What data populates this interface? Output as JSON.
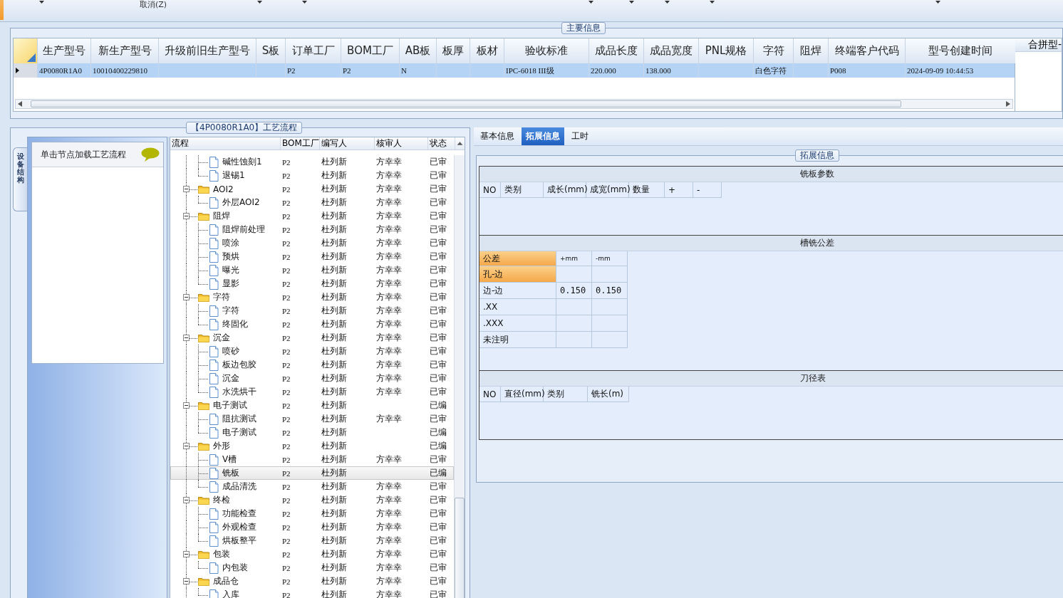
{
  "toolbar": {
    "cancel_label": "取消(Z)"
  },
  "main_info": {
    "title": "主要信息",
    "columns": [
      "生产型号",
      "新生产型号",
      "升级前旧生产型号",
      "S板",
      "订单工厂",
      "BOM工厂",
      "AB板",
      "板厚",
      "板材",
      "验收标准",
      "成品长度",
      "成品宽度",
      "PNL规格",
      "字符",
      "阻焊",
      "终端客户代码",
      "型号创建时间"
    ],
    "rows": [
      {
        "selected": true,
        "cells": [
          "4P0080R1A0",
          "10010400229810",
          null,
          null,
          "P2",
          "P2",
          "N",
          null,
          null,
          "IPC-6018 III级",
          "220.000",
          "138.000",
          null,
          "白色字符",
          null,
          "P008",
          "2024-09-09 10:44:53"
        ]
      }
    ],
    "side_header": "合拼型-"
  },
  "process": {
    "title": "【4P0080R1A0】工艺流程",
    "side_tab": "设备结构",
    "hint": "单击节点加载工艺流程",
    "columns": [
      "流程",
      "BOM工厂",
      "编写人",
      "核审人",
      "状态"
    ],
    "tree": [
      {
        "kind": "continued",
        "children": [
          {
            "kind": "leaf",
            "label": "碱性蚀刻1",
            "bom": "P2",
            "writer": "杜列新",
            "reviewer": "方幸幸",
            "status": "已审",
            "selected": false
          },
          {
            "kind": "leaf",
            "label": "退锡1",
            "bom": "P2",
            "writer": "杜列新",
            "reviewer": "方幸幸",
            "status": "已审",
            "selected": false
          }
        ]
      },
      {
        "kind": "folder",
        "label": "AOI2",
        "bom": "P2",
        "writer": "杜列新",
        "reviewer": "方幸幸",
        "status": "已审",
        "selected": false,
        "expanded": true,
        "children": [
          {
            "kind": "leaf",
            "label": "外层AOI2",
            "bom": "P2",
            "writer": "杜列新",
            "reviewer": "方幸幸",
            "status": "已审",
            "selected": false
          }
        ]
      },
      {
        "kind": "folder",
        "label": "阻焊",
        "bom": "P2",
        "writer": "杜列新",
        "reviewer": "方幸幸",
        "status": "已审",
        "selected": false,
        "expanded": true,
        "children": [
          {
            "kind": "leaf",
            "label": "阻焊前处理",
            "bom": "P2",
            "writer": "杜列新",
            "reviewer": "方幸幸",
            "status": "已审",
            "selected": false
          },
          {
            "kind": "leaf",
            "label": "喷涂",
            "bom": "P2",
            "writer": "杜列新",
            "reviewer": "方幸幸",
            "status": "已审",
            "selected": false
          },
          {
            "kind": "leaf",
            "label": "预烘",
            "bom": "P2",
            "writer": "杜列新",
            "reviewer": "方幸幸",
            "status": "已审",
            "selected": false
          },
          {
            "kind": "leaf",
            "label": "曝光",
            "bom": "P2",
            "writer": "杜列新",
            "reviewer": "方幸幸",
            "status": "已审",
            "selected": false
          },
          {
            "kind": "leaf",
            "label": "显影",
            "bom": "P2",
            "writer": "杜列新",
            "reviewer": "方幸幸",
            "status": "已审",
            "selected": false
          }
        ]
      },
      {
        "kind": "folder",
        "label": "字符",
        "bom": "P2",
        "writer": "杜列新",
        "reviewer": "方幸幸",
        "status": "已审",
        "selected": false,
        "expanded": true,
        "children": [
          {
            "kind": "leaf",
            "label": "字符",
            "bom": "P2",
            "writer": "杜列新",
            "reviewer": "方幸幸",
            "status": "已审",
            "selected": false
          },
          {
            "kind": "leaf",
            "label": "终固化",
            "bom": "P2",
            "writer": "杜列新",
            "reviewer": "方幸幸",
            "status": "已审",
            "selected": false
          }
        ]
      },
      {
        "kind": "folder",
        "label": "沉金",
        "bom": "P2",
        "writer": "杜列新",
        "reviewer": "方幸幸",
        "status": "已审",
        "selected": false,
        "expanded": true,
        "children": [
          {
            "kind": "leaf",
            "label": "喷砂",
            "bom": "P2",
            "writer": "杜列新",
            "reviewer": "方幸幸",
            "status": "已审",
            "selected": false
          },
          {
            "kind": "leaf",
            "label": "板边包胶",
            "bom": "P2",
            "writer": "杜列新",
            "reviewer": "方幸幸",
            "status": "已审",
            "selected": false
          },
          {
            "kind": "leaf",
            "label": "沉金",
            "bom": "P2",
            "writer": "杜列新",
            "reviewer": "方幸幸",
            "status": "已审",
            "selected": false
          },
          {
            "kind": "leaf",
            "label": "水洗烘干",
            "bom": "P2",
            "writer": "杜列新",
            "reviewer": "方幸幸",
            "status": "已审",
            "selected": false
          }
        ]
      },
      {
        "kind": "folder",
        "label": "电子测试",
        "bom": "P2",
        "writer": "杜列新",
        "status": "已编",
        "selected": false,
        "expanded": true,
        "children": [
          {
            "kind": "leaf",
            "label": "阻抗测试",
            "bom": "P2",
            "writer": "杜列新",
            "reviewer": "方幸幸",
            "status": "已审",
            "selected": false
          },
          {
            "kind": "leaf",
            "label": "电子测试",
            "bom": "P2",
            "writer": "杜列新",
            "status": "已编",
            "selected": false
          }
        ]
      },
      {
        "kind": "folder",
        "label": "外形",
        "bom": "P2",
        "writer": "杜列新",
        "status": "已编",
        "selected": false,
        "expanded": true,
        "children": [
          {
            "kind": "leaf",
            "label": "V槽",
            "bom": "P2",
            "writer": "杜列新",
            "reviewer": "方幸幸",
            "status": "已审",
            "selected": false
          },
          {
            "kind": "leaf",
            "label": "铣板",
            "bom": "P2",
            "writer": "杜列新",
            "status": "已编",
            "selected": true
          },
          {
            "kind": "leaf",
            "label": "成品清洗",
            "bom": "P2",
            "writer": "杜列新",
            "reviewer": "方幸幸",
            "status": "已审",
            "selected": false
          }
        ]
      },
      {
        "kind": "folder",
        "label": "终检",
        "bom": "P2",
        "writer": "杜列新",
        "reviewer": "方幸幸",
        "status": "已审",
        "selected": false,
        "expanded": true,
        "children": [
          {
            "kind": "leaf",
            "label": "功能检查",
            "bom": "P2",
            "writer": "杜列新",
            "reviewer": "方幸幸",
            "status": "已审",
            "selected": false
          },
          {
            "kind": "leaf",
            "label": "外观检查",
            "bom": "P2",
            "writer": "杜列新",
            "reviewer": "方幸幸",
            "status": "已审",
            "selected": false
          },
          {
            "kind": "leaf",
            "label": "烘板整平",
            "bom": "P2",
            "writer": "杜列新",
            "reviewer": "方幸幸",
            "status": "已审",
            "selected": false
          }
        ]
      },
      {
        "kind": "folder",
        "label": "包装",
        "bom": "P2",
        "writer": "杜列新",
        "reviewer": "方幸幸",
        "status": "已审",
        "selected": false,
        "expanded": true,
        "children": [
          {
            "kind": "leaf",
            "label": "内包装",
            "bom": "P2",
            "writer": "杜列新",
            "reviewer": "方幸幸",
            "status": "已审",
            "selected": false
          }
        ]
      },
      {
        "kind": "folder",
        "label": "成品仓",
        "bom": "P2",
        "writer": "杜列新",
        "reviewer": "方幸幸",
        "status": "已审",
        "selected": false,
        "expanded": true,
        "children": [
          {
            "kind": "leaf",
            "label": "入库",
            "bom": "P2",
            "writer": "杜列新",
            "reviewer": "方幸幸",
            "status": "已审",
            "selected": false
          }
        ]
      }
    ]
  },
  "detail": {
    "tabs": [
      {
        "label": "基本信息",
        "selected": false
      },
      {
        "label": "拓展信息",
        "selected": true
      },
      {
        "label": "工时",
        "selected": false
      }
    ],
    "group_title": "拓展信息",
    "milling": {
      "title": "铣板参数",
      "columns": [
        "NO",
        "类别",
        "成长(mm)",
        "成宽(mm)",
        "数量",
        "+",
        "-"
      ]
    },
    "tolerance": {
      "title": "槽铣公差",
      "columns": [
        "公差",
        "+mm",
        "-mm"
      ],
      "rows": [
        {
          "label": "孔-边",
          "selected": true
        },
        {
          "label": "边-边",
          "plus": "0.150",
          "minus": "0.150",
          "selected": false
        },
        {
          "label": ".XX",
          "selected": false
        },
        {
          "label": ".XXX",
          "selected": false
        },
        {
          "label": "未注明",
          "selected": false
        }
      ]
    },
    "cutters": {
      "title": "刀径表",
      "columns": [
        "NO",
        "直径(mm)",
        "类别",
        "铣长(m)"
      ]
    }
  }
}
